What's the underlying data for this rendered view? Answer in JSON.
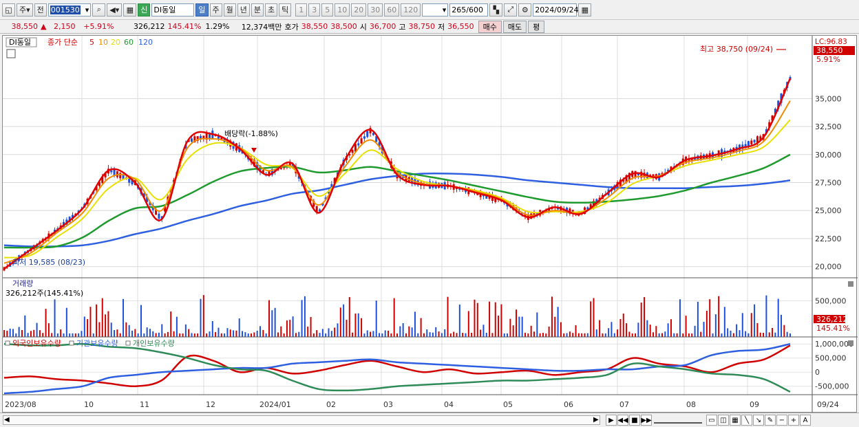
{
  "toolbar": {
    "period_type": "주",
    "prev_label": "전",
    "code": "001530",
    "sin_badge": "신",
    "stock_name": "DI동일",
    "period_tabs": [
      "일",
      "주",
      "월",
      "년",
      "분",
      "초",
      "틱"
    ],
    "active_tab": "일",
    "interval_buttons": [
      "1",
      "3",
      "5",
      "10",
      "20",
      "30",
      "60",
      "120"
    ],
    "count": "265",
    "count_max": "/600",
    "date": "2024/09/24"
  },
  "quote": {
    "price": "38,550",
    "arrow": "▲",
    "change": "2,150",
    "change_pct": "+5.91%",
    "volume": "326,212",
    "volume_ratio": "145.41%",
    "turnover": "1.29%",
    "amount": "12,374백만",
    "bid_label": "호가",
    "bid1": "38,550",
    "bid2": "38,500",
    "open_label": "시",
    "open": "36,700",
    "high_label": "고",
    "high": "38,750",
    "low_label": "저",
    "low": "36,550",
    "buy_button": "매수",
    "sell_button": "매도",
    "eval_button": "평"
  },
  "legend": {
    "name": "DI동일",
    "type": "종가 단순",
    "ma": [
      {
        "label": "5",
        "color": "#e00000"
      },
      {
        "label": "10",
        "color": "#f08c00"
      },
      {
        "label": "20",
        "color": "#e8e000"
      },
      {
        "label": "60",
        "color": "#1e9a2e"
      },
      {
        "label": "120",
        "color": "#2e5fe0"
      }
    ]
  },
  "annotations": {
    "high_marker": "최고 38,750 (09/24)",
    "low_marker": "최저 19,585 (08/23)",
    "dividend": "배당락(-1.88%)",
    "lc_label": "LC:96.83",
    "price_tag": "38,550",
    "pct_tag": "5.91%"
  },
  "volume_panel": {
    "title": "거래량",
    "info": "326,212주(145.41%)",
    "tick": "500,000",
    "tag_value": "326,212",
    "tag_pct": "145.41%"
  },
  "holding_panel": {
    "legend": [
      {
        "label": "외국인보유수량",
        "color": "#d00000"
      },
      {
        "label": "기관보유수량",
        "color": "#2e5fe0"
      },
      {
        "label": "개인보유수량",
        "color": "#2e8b57"
      }
    ],
    "ticks": [
      "1,000,000",
      "500,000",
      "0",
      "-500,000"
    ]
  },
  "colors": {
    "up": "#d00000",
    "down": "#1e4fd8",
    "grid": "#dcdcdc"
  },
  "chart_data": [
    {
      "type": "line",
      "title": "DI동일",
      "x": [
        "2023/08",
        "10",
        "11",
        "12",
        "2024/01",
        "02",
        "03",
        "04",
        "05",
        "06",
        "07",
        "08",
        "09",
        "09/24"
      ],
      "ylim": [
        19000,
        39500
      ],
      "yticks": [
        20000,
        22500,
        25000,
        27500,
        30000,
        32500,
        35000
      ],
      "series": [
        {
          "name": "5",
          "values": [
            19800,
            21500,
            23200,
            25200,
            28600,
            27500,
            24200,
            31200,
            31800,
            30500,
            28200,
            29200,
            24800,
            29500,
            32200,
            28200,
            27300,
            27200,
            26600,
            25900,
            24400,
            25300,
            24700,
            26500,
            28300,
            28000,
            29500,
            29900,
            30500,
            31600,
            36800
          ]
        },
        {
          "name": "10",
          "values": [
            20300,
            21200,
            23000,
            24800,
            27900,
            27800,
            25000,
            30600,
            31400,
            30600,
            28600,
            28900,
            25500,
            28900,
            31300,
            28400,
            27400,
            27200,
            26700,
            26000,
            24600,
            25000,
            24800,
            26100,
            27900,
            28100,
            29300,
            29700,
            30300,
            31200,
            34800
          ]
        },
        {
          "name": "20",
          "values": [
            20800,
            21000,
            22600,
            24300,
            27000,
            27900,
            26000,
            29600,
            31000,
            30600,
            29100,
            28800,
            26300,
            28300,
            30400,
            28700,
            27600,
            27200,
            26800,
            26100,
            24900,
            24900,
            24900,
            25700,
            27400,
            28100,
            29000,
            29500,
            30000,
            30700,
            33100
          ]
        },
        {
          "name": "60",
          "values": [
            21700,
            21700,
            21800,
            22600,
            24100,
            25200,
            25400,
            26400,
            27600,
            28500,
            28800,
            28900,
            28400,
            28600,
            28900,
            28500,
            28100,
            27700,
            27200,
            26700,
            26200,
            25800,
            25700,
            25800,
            26000,
            26300,
            26800,
            27500,
            28100,
            28800,
            30000
          ]
        },
        {
          "name": "120",
          "values": [
            21900,
            21800,
            21800,
            21900,
            22300,
            22900,
            23400,
            24100,
            24700,
            25400,
            25900,
            26500,
            26800,
            27300,
            27800,
            28100,
            28300,
            28300,
            28200,
            28000,
            27700,
            27500,
            27300,
            27100,
            27000,
            27000,
            27000,
            27100,
            27200,
            27400,
            27700
          ]
        }
      ]
    },
    {
      "type": "bar",
      "title": "거래량",
      "ylim": [
        0,
        800000
      ],
      "yticks": [
        500000
      ]
    },
    {
      "type": "line",
      "title": "보유수량",
      "ylim": [
        -800000,
        1200000
      ],
      "yticks": [
        1000000,
        500000,
        0,
        -500000
      ],
      "series": [
        {
          "name": "외국인보유수량",
          "values": [
            -200000,
            -150000,
            -250000,
            -300000,
            -400000,
            -500000,
            -300000,
            550000,
            400000,
            0,
            150000,
            -50000,
            50000,
            250000,
            400000,
            200000,
            0,
            100000,
            -50000,
            0,
            50000,
            -100000,
            0,
            100000,
            500000,
            300000,
            200000,
            0,
            300000,
            450000,
            950000
          ]
        },
        {
          "name": "기관보유수량",
          "values": [
            -750000,
            -700000,
            -600000,
            -500000,
            -200000,
            -100000,
            0,
            50000,
            100000,
            150000,
            150000,
            300000,
            350000,
            400000,
            450000,
            350000,
            300000,
            250000,
            200000,
            150000,
            100000,
            50000,
            50000,
            100000,
            100000,
            200000,
            250000,
            600000,
            750000,
            800000,
            1000000
          ]
        },
        {
          "name": "개인보유수량",
          "values": [
            1000000,
            950000,
            950000,
            1000000,
            900000,
            850000,
            700000,
            500000,
            250000,
            100000,
            50000,
            -300000,
            -600000,
            -650000,
            -600000,
            -500000,
            -450000,
            -400000,
            -350000,
            -300000,
            -300000,
            -250000,
            -200000,
            -100000,
            300000,
            200000,
            100000,
            -50000,
            -100000,
            -250000,
            -700000
          ]
        }
      ]
    }
  ]
}
